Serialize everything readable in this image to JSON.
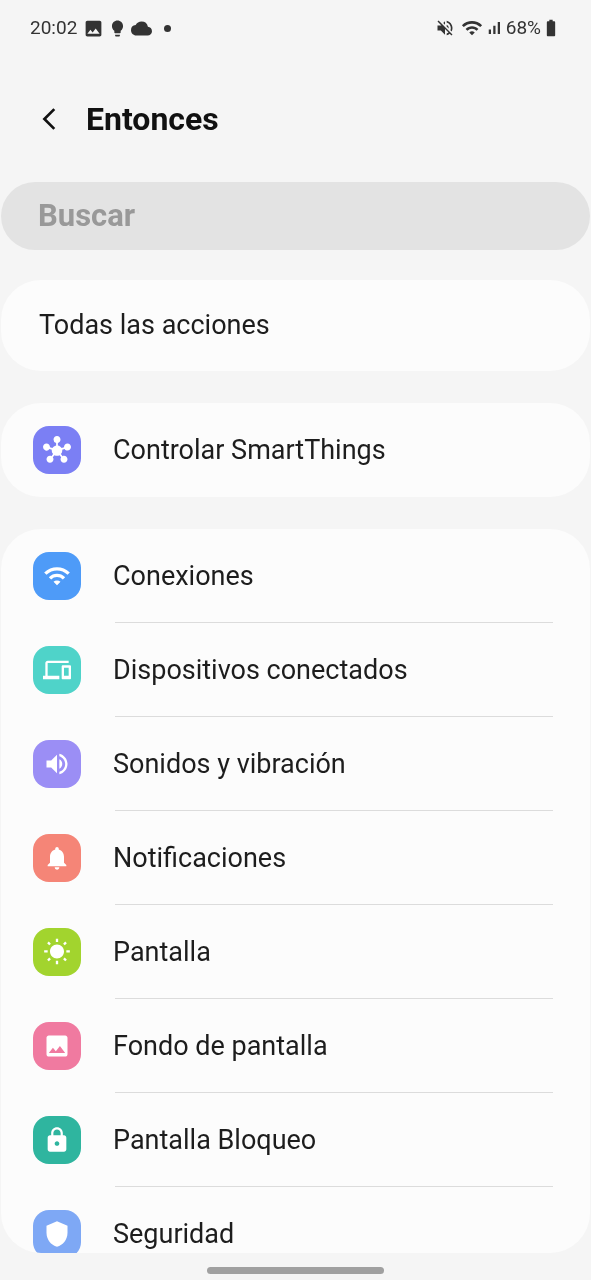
{
  "status_bar": {
    "time": "20:02",
    "battery": "68%"
  },
  "header": {
    "title": "Entonces"
  },
  "search": {
    "placeholder": "Buscar"
  },
  "all_actions": {
    "label": "Todas las acciones"
  },
  "smartthings": [
    {
      "label": "Controlar SmartThings",
      "kind": "hub",
      "color": "#7b7ff4"
    }
  ],
  "settings": [
    {
      "label": "Conexiones",
      "kind": "wifi",
      "color": "#4e9bf8"
    },
    {
      "label": "Dispositivos conectados",
      "kind": "devices",
      "color": "#4fd3c9"
    },
    {
      "label": "Sonidos y vibración",
      "kind": "sound",
      "color": "#9b8ef5"
    },
    {
      "label": "Notificaciones",
      "kind": "notification",
      "color": "#f58577"
    },
    {
      "label": "Pantalla",
      "kind": "display",
      "color": "#a2d42e"
    },
    {
      "label": "Fondo de pantalla",
      "kind": "wallpaper",
      "color": "#f07aa0"
    },
    {
      "label": "Pantalla Bloqueo",
      "kind": "lock",
      "color": "#2fb59f"
    },
    {
      "label": "Seguridad",
      "kind": "security",
      "color": "#7ea8f5"
    }
  ]
}
